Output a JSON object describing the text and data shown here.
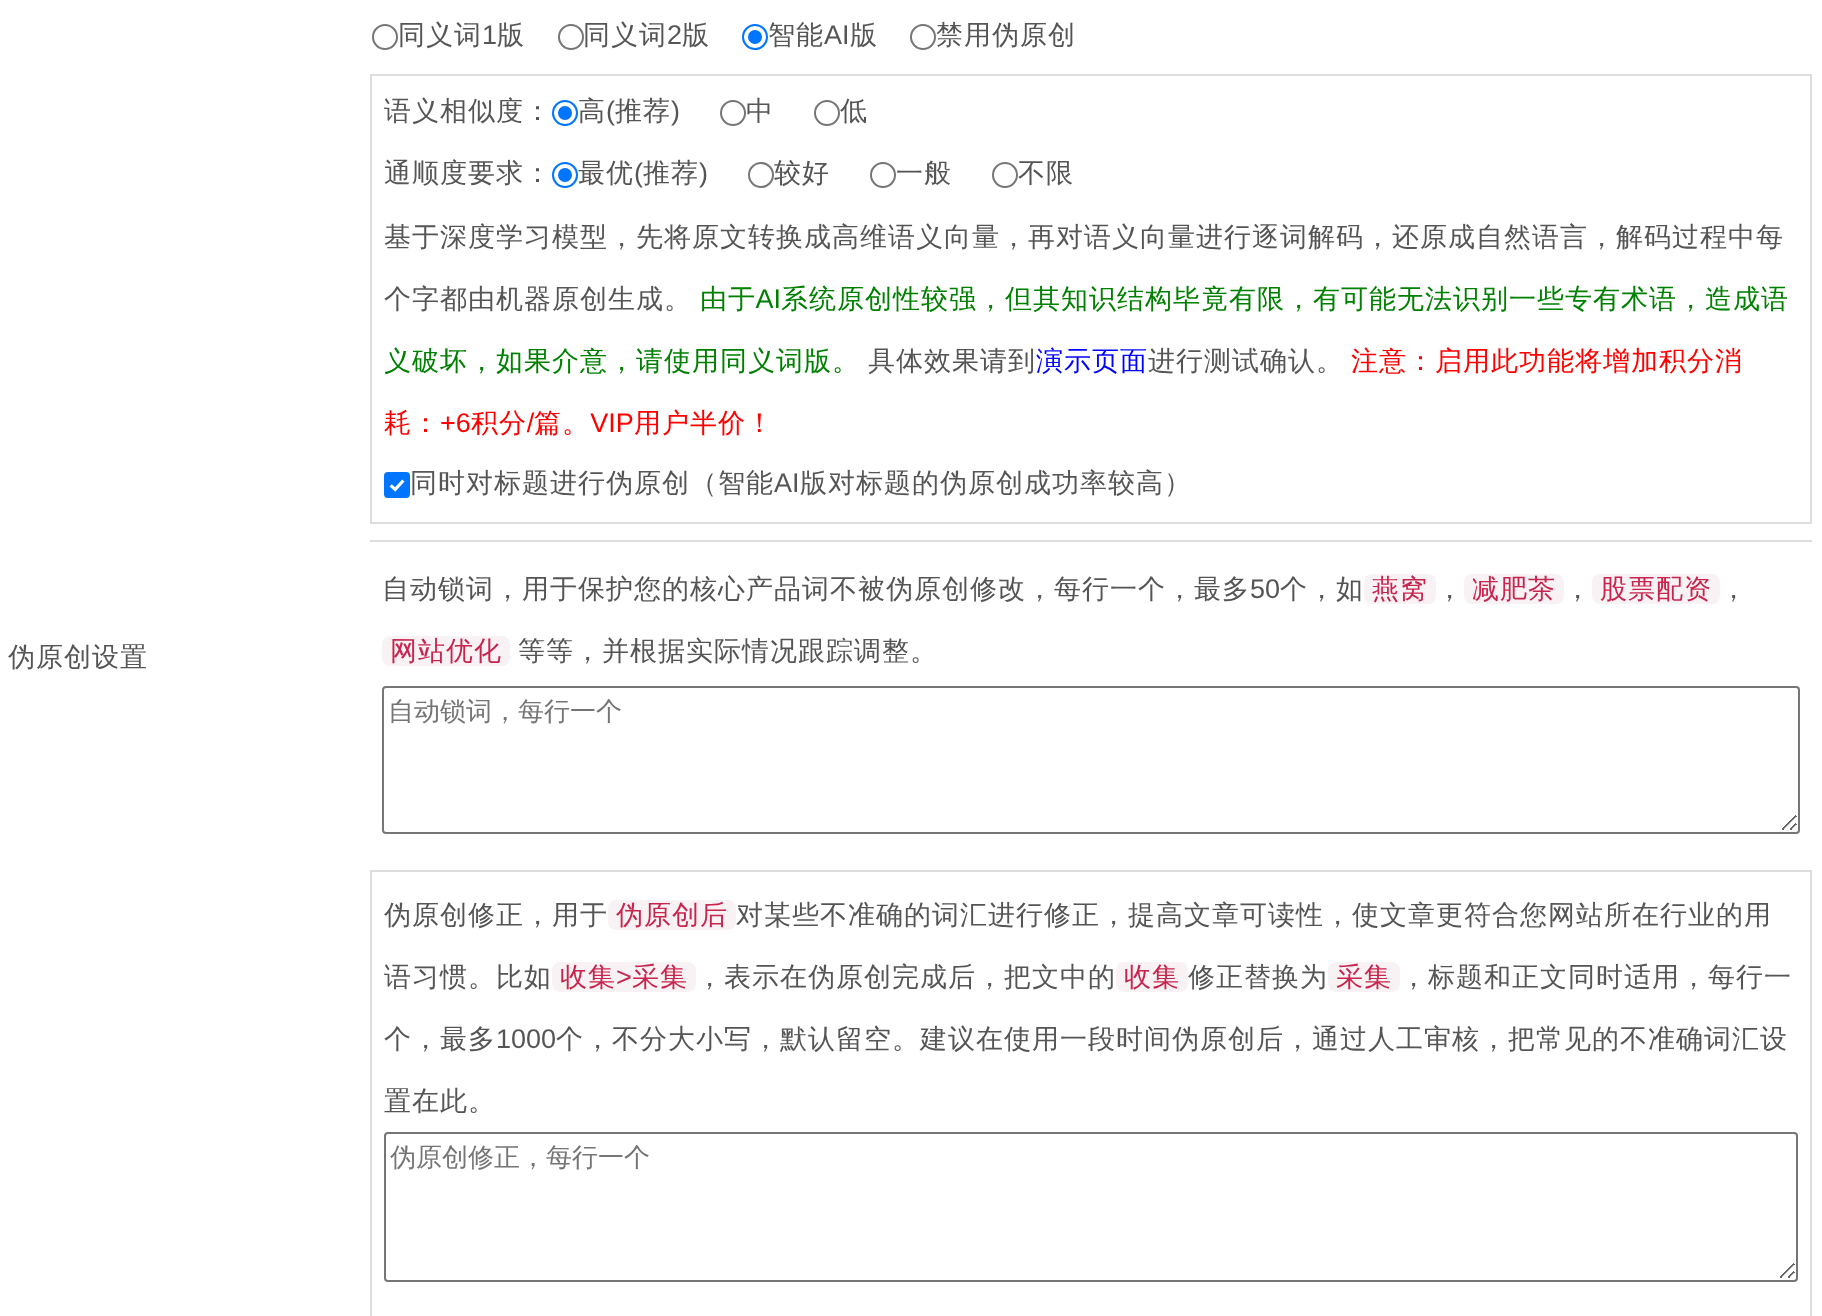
{
  "section_label": "伪原创设置",
  "modes": [
    {
      "label": "同义词1版",
      "selected": false
    },
    {
      "label": "同义词2版",
      "selected": false
    },
    {
      "label": "智能AI版",
      "selected": true
    },
    {
      "label": "禁用伪原创",
      "selected": false
    }
  ],
  "ai_settings": {
    "similarity": {
      "label": "语义相似度：",
      "options": [
        {
          "label": "高(推荐)",
          "selected": true
        },
        {
          "label": "中",
          "selected": false
        },
        {
          "label": "低",
          "selected": false
        }
      ]
    },
    "fluency": {
      "label": "通顺度要求：",
      "options": [
        {
          "label": "最优(推荐)",
          "selected": true
        },
        {
          "label": "较好",
          "selected": false
        },
        {
          "label": "一般",
          "selected": false
        },
        {
          "label": "不限",
          "selected": false
        }
      ]
    },
    "description": [
      {
        "kind": "plain",
        "text": "基于深度学习模型，先将原文转换成高维语义向量，再对语义向量进行逐词解码，还原成自然语言，解码过程中每个字都由机器原创生成。 "
      },
      {
        "kind": "hint",
        "text": "由于AI系统原创性较强，但其知识结构毕竟有限，有可能无法识别一些专有术语，造成语义破坏，如果介意，请使用同义词版。"
      },
      {
        "kind": "plain",
        "text": " 具体效果请到"
      },
      {
        "kind": "link",
        "text": "演示页面"
      },
      {
        "kind": "plain",
        "text": "进行测试确认。 "
      },
      {
        "kind": "warning",
        "text": "注意：启用此功能将增加积分消耗：+6积分/篇。VIP用户半价！"
      }
    ],
    "title_option": {
      "label": "同时对标题进行伪原创（智能AI版对标题的伪原创成功率较高）",
      "checked": true
    }
  },
  "lock_words": {
    "description": [
      {
        "kind": "plain",
        "text": "自动锁词，用于保护您的核心产品词不被伪原创修改，每行一个，最多50个，如"
      },
      {
        "kind": "code",
        "text": "燕窝"
      },
      {
        "kind": "plain",
        "text": "，"
      },
      {
        "kind": "code",
        "text": "减肥茶"
      },
      {
        "kind": "plain",
        "text": "，"
      },
      {
        "kind": "code",
        "text": "股票配资"
      },
      {
        "kind": "plain",
        "text": "，"
      },
      {
        "kind": "code",
        "text": "网站优化"
      },
      {
        "kind": "plain",
        "text": " 等等，并根据实际情况跟踪调整。"
      }
    ],
    "placeholder": "自动锁词，每行一个"
  },
  "corrections": {
    "description": [
      {
        "kind": "plain",
        "text": "伪原创修正，用于"
      },
      {
        "kind": "code",
        "text": "伪原创后"
      },
      {
        "kind": "plain",
        "text": "对某些不准确的词汇进行修正，提高文章可读性，使文章更符合您网站所在行业的用语习惯。比如"
      },
      {
        "kind": "code",
        "text": "收集>采集"
      },
      {
        "kind": "plain",
        "text": "，表示在伪原创完成后，把文中的"
      },
      {
        "kind": "code",
        "text": "收集"
      },
      {
        "kind": "plain",
        "text": "修正替换为"
      },
      {
        "kind": "code",
        "text": "采集"
      },
      {
        "kind": "plain",
        "text": "，标题和正文同时适用，每行一个，最多1000个，不分大小写，默认留空。建议在使用一段时间伪原创后，通过人工审核，把常见的不准确词汇设置在此。"
      }
    ],
    "placeholder": "伪原创修正，每行一个"
  }
}
